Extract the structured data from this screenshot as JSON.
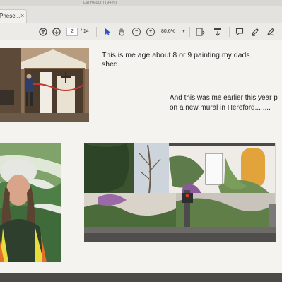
{
  "window": {
    "title_fragment": "Lal Reborn (94%)"
  },
  "tab": {
    "label": "Phese...",
    "close": "×"
  },
  "toolbar": {
    "prev_icon": "arrow-up-circle-icon",
    "next_icon": "arrow-down-circle-icon",
    "page_current": "2",
    "page_total": "/ 14",
    "zoom": "80.6%"
  },
  "page": {
    "caption_1": "This is me age about 8 or 9 painting my dads shed.",
    "caption_2_line1": "And this was me earlier this year p",
    "caption_2_line2": "on a new mural in Hereford........"
  }
}
